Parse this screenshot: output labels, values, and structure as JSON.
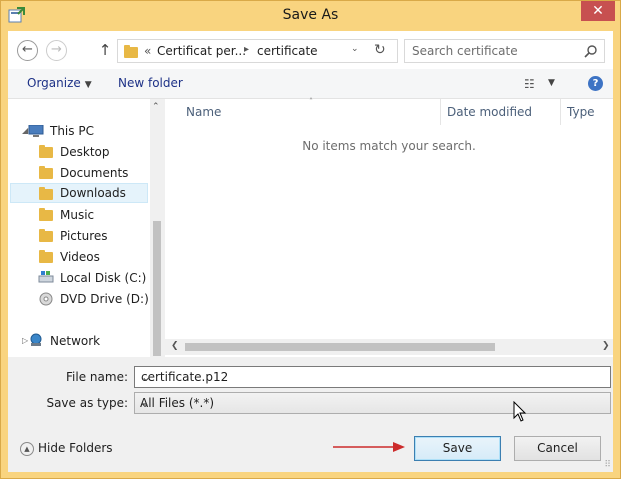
{
  "window": {
    "title": "Save As",
    "close_label": "✕"
  },
  "nav": {
    "back_label": "←",
    "forward_label": "→",
    "up_label": "↑",
    "address": {
      "overflow": "«",
      "crumbs": [
        "Certificat per...",
        "certificate"
      ],
      "separator": "▸",
      "dropdown": "⌄",
      "refresh": "↻"
    },
    "search": {
      "placeholder": "Search certificate",
      "icon": "search-icon"
    }
  },
  "commands": {
    "organize": "Organize",
    "organize_caret": "▼",
    "new_folder": "New folder",
    "view_label": "☷",
    "view_caret": "▼",
    "help_label": "?"
  },
  "sidebar": {
    "items": [
      {
        "label": "This PC",
        "icon": "pc-icon"
      },
      {
        "label": "Desktop",
        "icon": "folder-icon"
      },
      {
        "label": "Documents",
        "icon": "folder-icon"
      },
      {
        "label": "Downloads",
        "icon": "downloads-folder-icon",
        "selected": true
      },
      {
        "label": "Music",
        "icon": "folder-icon"
      },
      {
        "label": "Pictures",
        "icon": "folder-icon"
      },
      {
        "label": "Videos",
        "icon": "folder-icon"
      },
      {
        "label": "Local Disk (C:)",
        "icon": "disk-icon"
      },
      {
        "label": "DVD Drive (D:) Di",
        "icon": "dvd-icon"
      },
      {
        "label": "Network",
        "icon": "network-icon"
      }
    ],
    "tree_expanded": "◢",
    "tree_collapsed": "▷",
    "scroll_up": "⌃",
    "scroll_down": "⌄"
  },
  "file_list": {
    "columns": [
      "Name",
      "Date modified",
      "Type"
    ],
    "sort_caret": "˄",
    "empty_message": "No items match your search.",
    "scroll_left": "❮",
    "scroll_right": "❯"
  },
  "form": {
    "filename_label": "File name:",
    "filename_value": "certificate.p12",
    "type_label": "Save as type:",
    "type_value": "All Files (*.*)",
    "combo_caret": "⌄",
    "hide_folders_label": "Hide Folders",
    "hide_folders_icon": "▲",
    "save_label": "Save",
    "cancel_label": "Cancel",
    "grip": "⠿"
  },
  "colors": {
    "frame": "#f9d47f",
    "close": "#c75050",
    "selection": "#e5f3fb",
    "annotation_arrow": "#cc2b2b"
  }
}
